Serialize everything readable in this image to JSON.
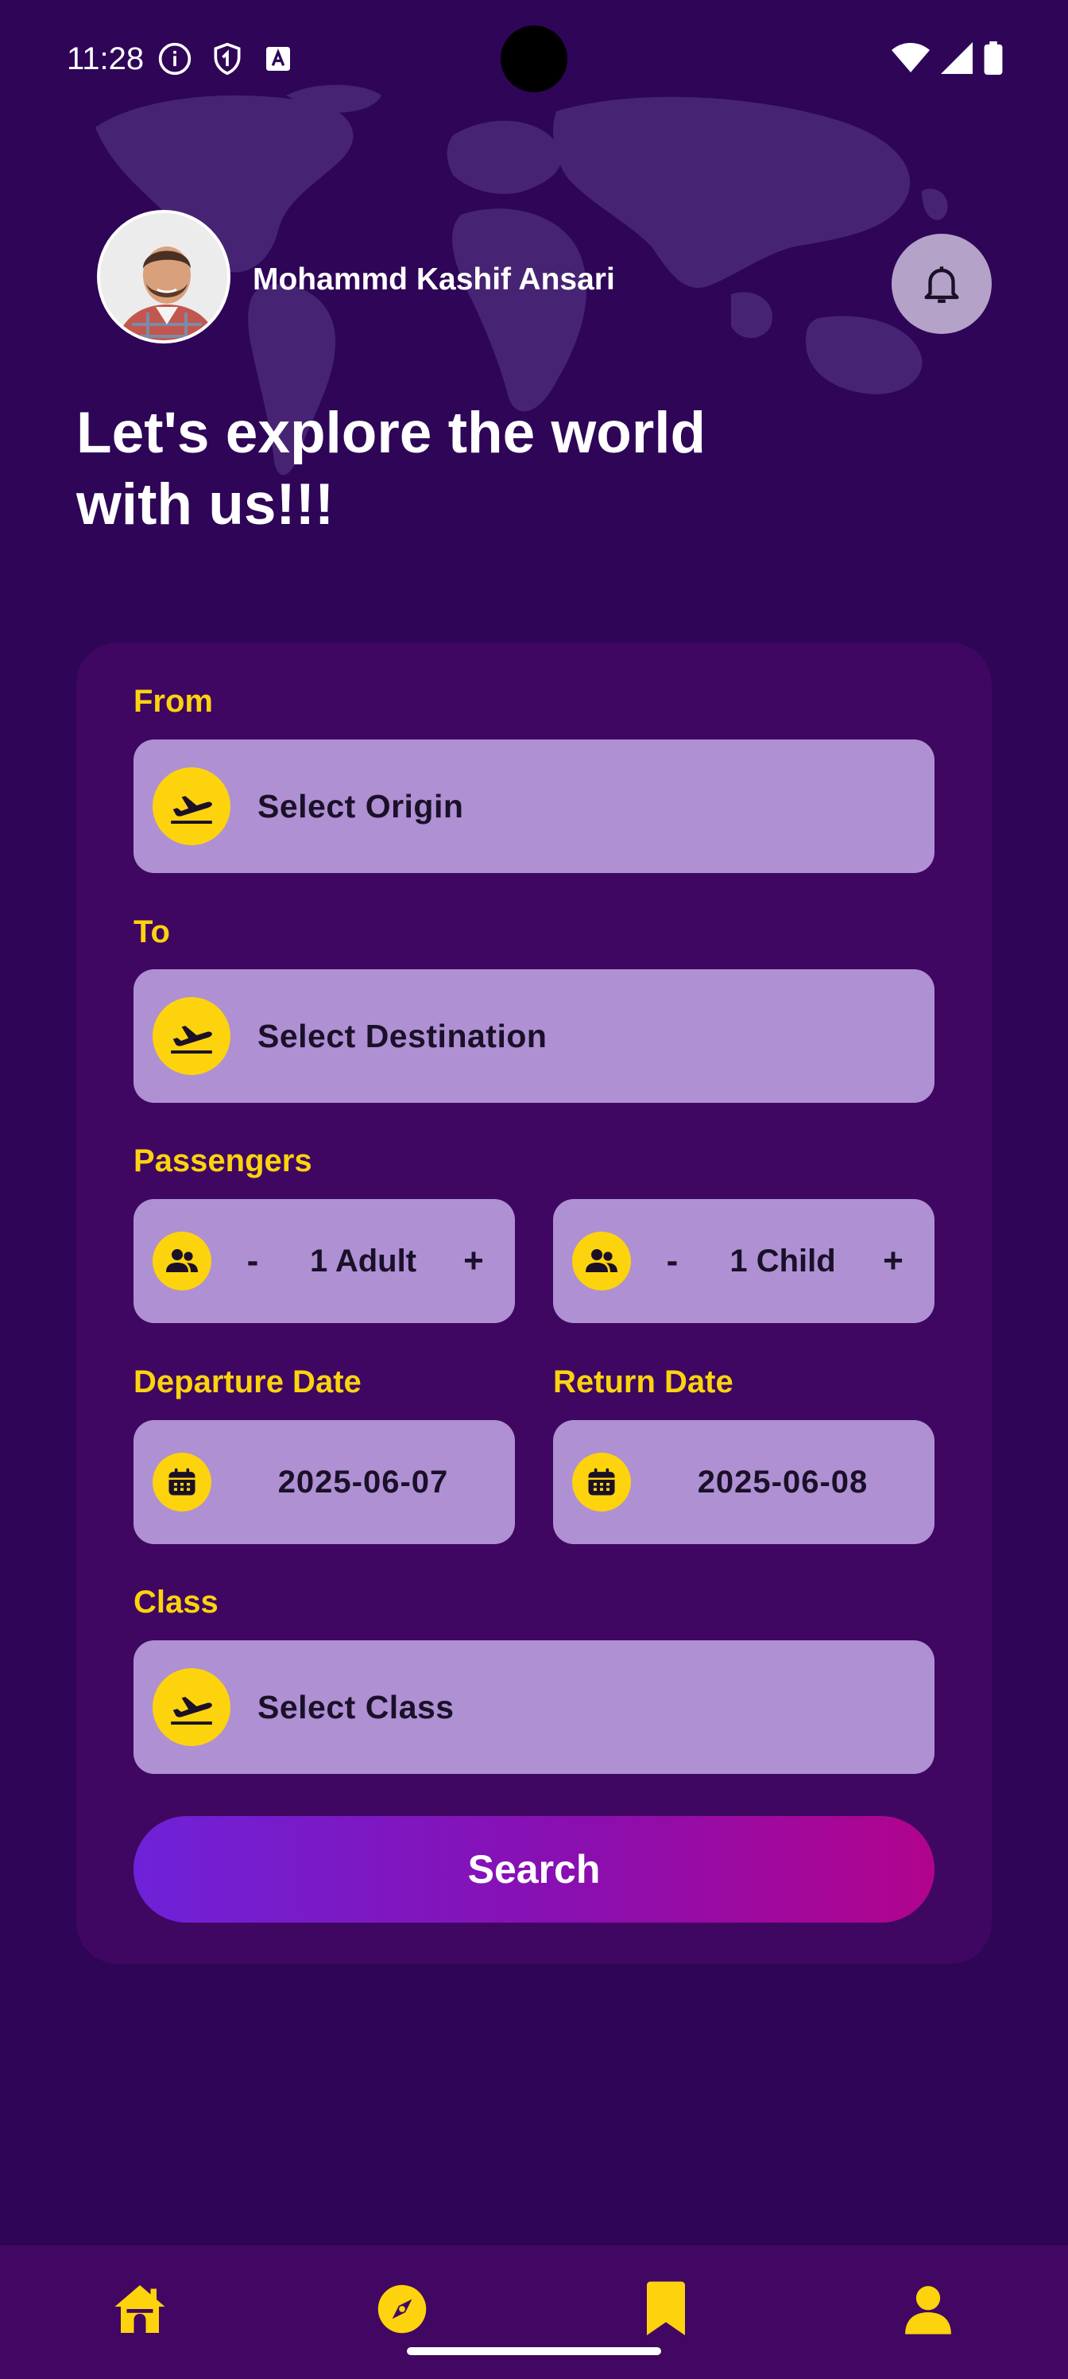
{
  "status_bar": {
    "time": "11:28"
  },
  "header": {
    "user_name": "Mohammd Kashif Ansari",
    "headline": "Let's explore the world\n with us!!!"
  },
  "form": {
    "from_label": "From",
    "from_placeholder": "Select Origin",
    "to_label": "To",
    "to_placeholder": "Select Destination",
    "passengers_label": "Passengers",
    "adults": {
      "minus": "-",
      "value": "1 Adult",
      "plus": "+"
    },
    "children": {
      "minus": "-",
      "value": "1 Child",
      "plus": "+"
    },
    "departure_label": "Departure Date",
    "departure_value": "2025-06-07",
    "return_label": "Return Date",
    "return_value": "2025-06-08",
    "class_label": "Class",
    "class_placeholder": "Select Class",
    "search_label": "Search"
  },
  "nav": {
    "items": [
      "home-icon",
      "compass-icon",
      "bookmark-icon",
      "profile-icon"
    ]
  },
  "colors": {
    "background": "#2e0557",
    "card": "#3f0761",
    "accent_yellow": "#fdd30e",
    "field": "#ae90d3",
    "gradient_start": "#6e22d8",
    "gradient_end": "#b1048d"
  }
}
